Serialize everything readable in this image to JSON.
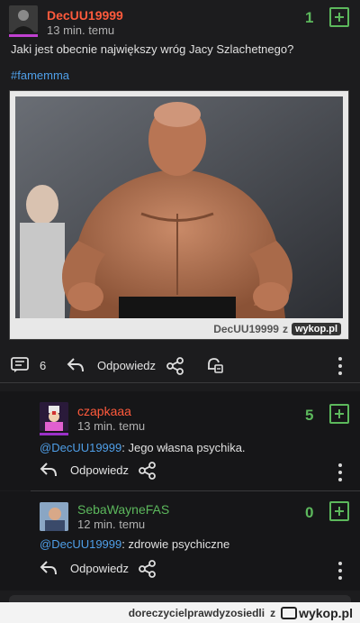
{
  "post": {
    "author": "DecUU19999",
    "time": "13 min. temu",
    "votes": "1",
    "text": "Jaki jest obecnie największy wróg Jacy Szlachetnego?",
    "tag": "#famemma",
    "watermark_user": "DecUU19999",
    "watermark_z": "z",
    "watermark_site": "wykop.pl",
    "comments_count": "6",
    "reply_label": "Odpowiedz"
  },
  "comments": [
    {
      "author": "czapkaaa",
      "time": "13 min. temu",
      "votes": "5",
      "mention": "@DecUU19999",
      "text": ": Jego własna psychika.",
      "reply_label": "Odpowiedz"
    },
    {
      "author": "SebaWayneFAS",
      "time": "12 min. temu",
      "votes": "0",
      "mention": "@DecUU19999",
      "text": ": zdrowie psychiczne",
      "reply_label": "Odpowiedz"
    }
  ],
  "footer": {
    "text": "doreczycielprawdyzosiedli",
    "z": "z",
    "site": "wykop.pl"
  },
  "colors": {
    "author_post": "#ff5a3c",
    "author_czapkaaa": "#ff5a3c",
    "author_seba": "#5cb85c",
    "vote_green": "#5cb85c",
    "link_blue": "#4f9fe8"
  },
  "icons": [
    "comments-icon",
    "reply-icon",
    "share-icon",
    "notify-bell-icon",
    "more-icon",
    "plus-vote-icon"
  ]
}
